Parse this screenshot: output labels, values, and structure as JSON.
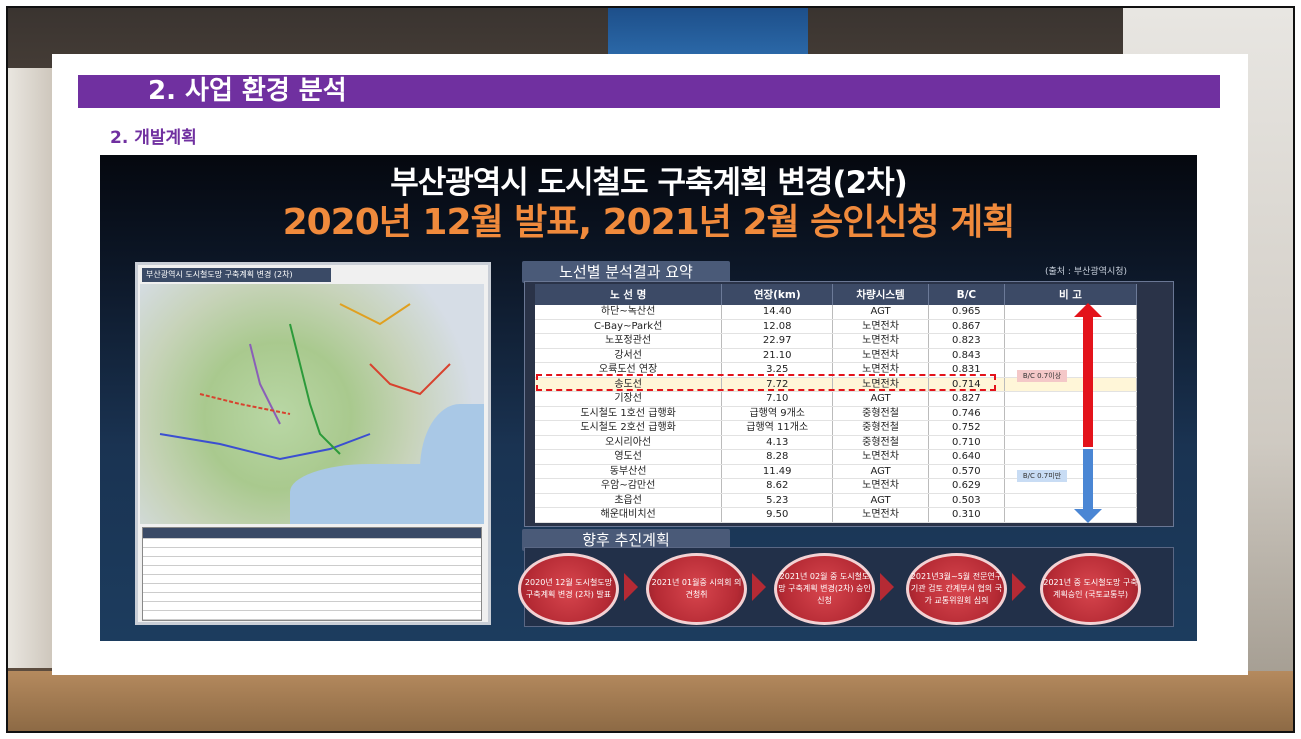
{
  "section": {
    "title": "2. 사업 환경 분석",
    "subtitle": "2. 개발계획"
  },
  "slide": {
    "title_line1": "부산광역시 도시철도 구축계획 변경(2차)",
    "title_line2": "2020년  12월 발표, 2021년 2월 승인신청 계획",
    "map_header": "부산광역시 도시철도망 구축계획 변경 (2차)",
    "summary_tab": "노선별 분석결과 요약",
    "source": "(출처 : 부산광역시청)",
    "table": {
      "headers": [
        "노 선 명",
        "연장(km)",
        "차량시스템",
        "B/C",
        "비 고"
      ],
      "rows": [
        [
          "하단~녹산선",
          "14.40",
          "AGT",
          "0.965"
        ],
        [
          "C-Bay~Park선",
          "12.08",
          "노면전차",
          "0.867"
        ],
        [
          "노포정관선",
          "22.97",
          "노면전차",
          "0.823"
        ],
        [
          "강서선",
          "21.10",
          "노면전차",
          "0.843"
        ],
        [
          "오륙도선 연장",
          "3.25",
          "노면전차",
          "0.831"
        ],
        [
          "송도선",
          "7.72",
          "노면전차",
          "0.714"
        ],
        [
          "기장선",
          "7.10",
          "AGT",
          "0.827"
        ],
        [
          "도시철도 1호선 급행화",
          "급행역 9개소",
          "중형전철",
          "0.746"
        ],
        [
          "도시철도 2호선 급행화",
          "급행역 11개소",
          "중형전철",
          "0.752"
        ],
        [
          "오시리아선",
          "4.13",
          "중형전철",
          "0.710"
        ],
        [
          "영도선",
          "8.28",
          "노면전차",
          "0.640"
        ],
        [
          "동부산선",
          "11.49",
          "AGT",
          "0.570"
        ],
        [
          "우암~감만선",
          "8.62",
          "노면전차",
          "0.629"
        ],
        [
          "초읍선",
          "5.23",
          "AGT",
          "0.503"
        ],
        [
          "해운대비치선",
          "9.50",
          "노면전차",
          "0.310"
        ]
      ],
      "bc_above": "B/C 0.7이상",
      "bc_below": "B/C 0.7미만"
    },
    "plan_tab": "향후 추진계획",
    "steps": [
      "2020년 12월 도시철도망 구축계획 변경 (2차) 발표",
      "2021년 01월중 시의회 의견청취",
      "2021년 02월 중 도시철도망 구축계획 변경(2차) 승인신청",
      "2021년3월~5월 전문연구기관 검토 간계부서 협의 국가 교통위원회 심의",
      "2021년 중 도시철도망 구축계획승인 (국토교통부)"
    ]
  },
  "colors": {
    "section_bar": "#7030a0",
    "title_orange": "#f08a3c",
    "arrow_red": "#e3131b",
    "arrow_blue": "#4a86d4"
  }
}
